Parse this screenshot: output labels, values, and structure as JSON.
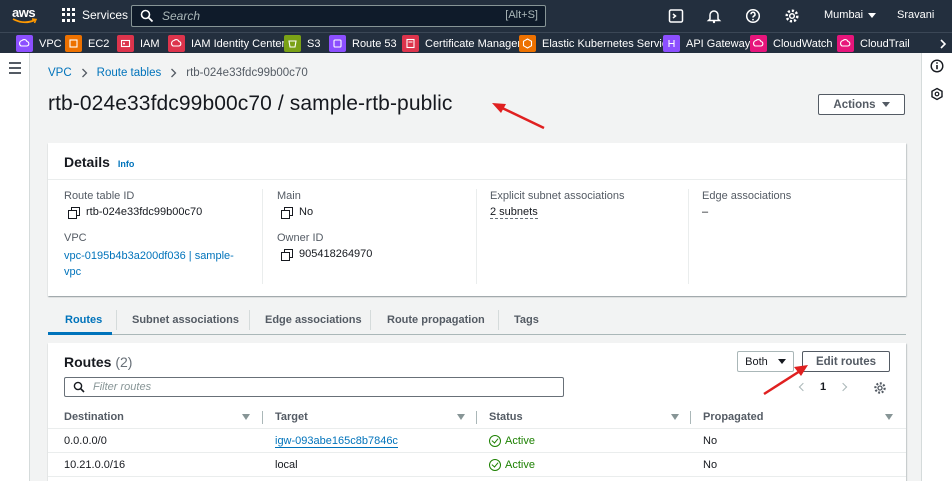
{
  "topnav": {
    "logo": "aws",
    "services_label": "Services",
    "search_placeholder": "Search",
    "search_shortcut": "[Alt+S]",
    "region": "Mumbai",
    "user": "Sravani"
  },
  "favorites": [
    {
      "label": "VPC",
      "color": "#8c4fff"
    },
    {
      "label": "EC2",
      "color": "#ed7100"
    },
    {
      "label": "IAM",
      "color": "#dd344c"
    },
    {
      "label": "IAM Identity Center",
      "color": "#dd344c"
    },
    {
      "label": "S3",
      "color": "#7aa116"
    },
    {
      "label": "Route 53",
      "color": "#8c4fff"
    },
    {
      "label": "Certificate Manager",
      "color": "#dd344c"
    },
    {
      "label": "Elastic Kubernetes Service",
      "color": "#ed7100"
    },
    {
      "label": "API Gateway",
      "color": "#8c4fff"
    },
    {
      "label": "CloudWatch",
      "color": "#e7157b"
    },
    {
      "label": "CloudTrail",
      "color": "#e7157b"
    }
  ],
  "breadcrumb": {
    "vpc": "VPC",
    "route_tables": "Route tables",
    "current": "rtb-024e33fdc99b00c70"
  },
  "page_title": "rtb-024e33fdc99b00c70 / sample-rtb-public",
  "actions_label": "Actions",
  "details": {
    "heading": "Details",
    "info": "Info",
    "route_table_id_label": "Route table ID",
    "route_table_id": "rtb-024e33fdc99b00c70",
    "vpc_label": "VPC",
    "vpc_line1": "vpc-0195b4b3a200df036 | sample-",
    "vpc_line2": "vpc",
    "main_label": "Main",
    "main_value": "No",
    "owner_label": "Owner ID",
    "owner_value": "905418264970",
    "explicit_label": "Explicit subnet associations",
    "explicit_value": "2 subnets",
    "edge_label": "Edge associations",
    "edge_value": "–"
  },
  "tabs": [
    "Routes",
    "Subnet associations",
    "Edge associations",
    "Route propagation",
    "Tags"
  ],
  "routes": {
    "heading": "Routes",
    "count": "(2)",
    "filter_selected": "Both",
    "edit_label": "Edit routes",
    "filter_placeholder": "Filter routes",
    "page": "1",
    "columns": [
      "Destination",
      "Target",
      "Status",
      "Propagated"
    ],
    "rows": [
      {
        "destination": "0.0.0.0/0",
        "target": "igw-093abe165c8b7846c",
        "status": "Active",
        "propagated": "No"
      },
      {
        "destination": "10.21.0.0/16",
        "target": "local",
        "status": "Active",
        "propagated": "No"
      }
    ]
  }
}
